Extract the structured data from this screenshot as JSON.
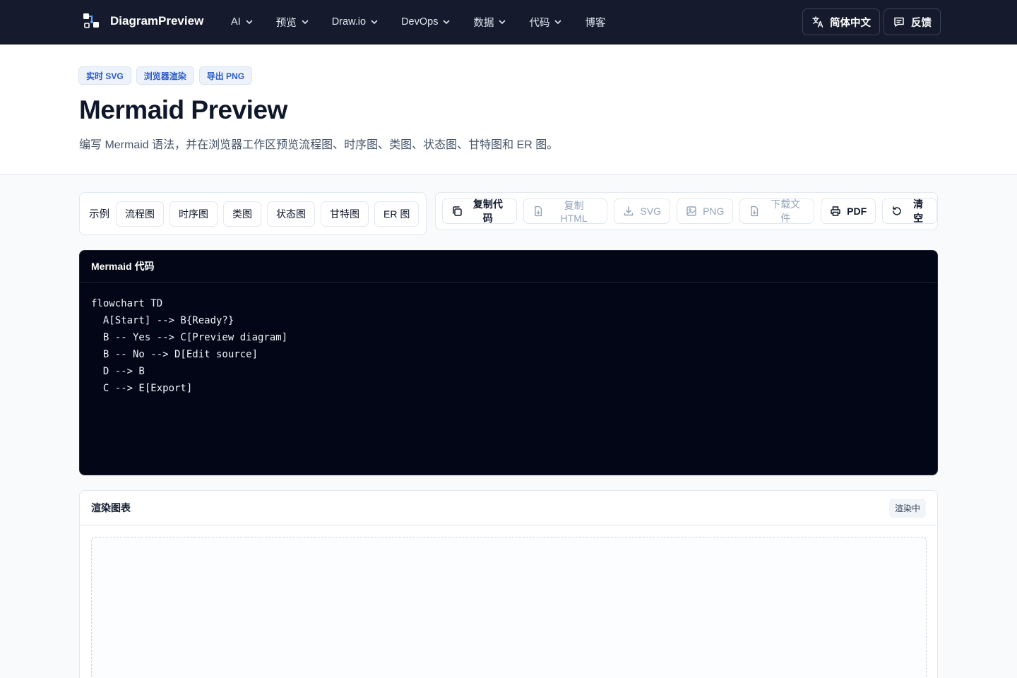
{
  "brand": {
    "name": "DiagramPreview"
  },
  "nav": {
    "items": [
      {
        "label": "AI"
      },
      {
        "label": "预览"
      },
      {
        "label": "Draw.io"
      },
      {
        "label": "DevOps"
      },
      {
        "label": "数据"
      },
      {
        "label": "代码"
      },
      {
        "label": "博客"
      }
    ],
    "language_label": "简体中文",
    "feedback_label": "反馈"
  },
  "hero": {
    "chips": [
      "实时 SVG",
      "浏览器渲染",
      "导出 PNG"
    ],
    "title": "Mermaid Preview",
    "subtitle": "编写 Mermaid 语法，并在浏览器工作区预览流程图、时序图、类图、状态图、甘特图和 ER 图。"
  },
  "examples": {
    "label": "示例",
    "items": [
      "流程图",
      "时序图",
      "类图",
      "状态图",
      "甘特图",
      "ER 图"
    ]
  },
  "actions": {
    "copy_code": "复制代码",
    "copy_html": "复制 HTML",
    "svg": "SVG",
    "png": "PNG",
    "download": "下载文件",
    "pdf": "PDF",
    "clear": "清空"
  },
  "editor": {
    "title": "Mermaid 代码",
    "code": "flowchart TD\n  A[Start] --> B{Ready?}\n  B -- Yes --> C[Preview diagram]\n  B -- No --> D[Edit source]\n  D --> B\n  C --> E[Export]"
  },
  "render": {
    "title": "渲染图表",
    "status": "渲染中"
  },
  "colors": {
    "nav_bg": "#151b2c",
    "chip_text": "#2c5cc5",
    "editor_bg": "#030617"
  }
}
